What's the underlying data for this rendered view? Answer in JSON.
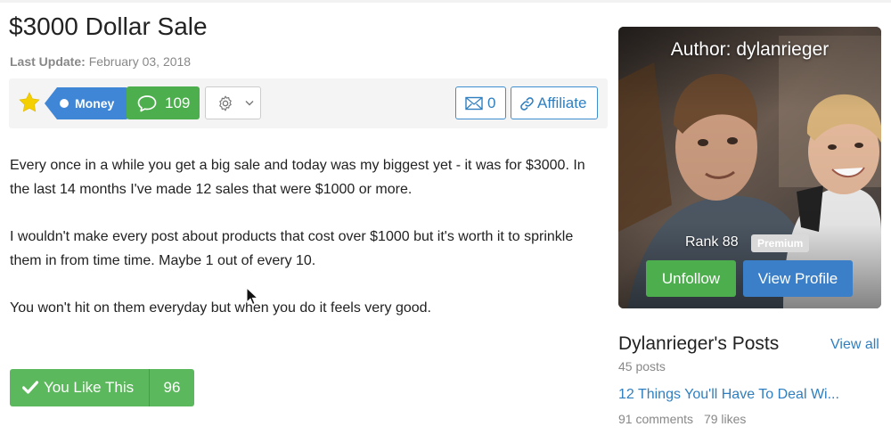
{
  "post": {
    "title": "$3000 Dollar Sale",
    "last_update_label": "Last Update:",
    "last_update_date": "February 03, 2018",
    "tag": "Money",
    "comment_count": "109",
    "message_count": "0",
    "affiliate_label": "Affiliate",
    "paragraphs": [
      "Every once in a while you get a big sale and today was my biggest yet - it was for $3000. In the last 14 months I've made 12 sales that were $1000 or more.",
      "I wouldn't make every post about products that cost over $1000 but it's worth it to sprinkle them in from time time. Maybe 1 out of every 10.",
      "You won't hit on them everyday but when you do it feels very good."
    ],
    "like_label": "You Like This",
    "like_count": "96"
  },
  "author": {
    "title": "Author: dylanrieger",
    "rank": "Rank 88",
    "badge": "Premium",
    "unfollow_label": "Unfollow",
    "view_profile_label": "View Profile"
  },
  "sidebar": {
    "heading": "Dylanrieger's Posts",
    "view_all": "View all",
    "posts_count": "45 posts",
    "recent_post": {
      "title": "12 Things You'll Have To Deal Wi...",
      "comments": "91 comments",
      "likes": "79 likes"
    }
  },
  "colors": {
    "green": "#4cae4c",
    "blue": "#3a7fc7",
    "link": "#2f7fc0",
    "tag_blue": "#3f86d6"
  },
  "icons": {
    "star": "star-icon",
    "tag_dot": "dot-icon",
    "comments": "speech-bubble-icon",
    "settings": "gear-icon",
    "dropdown": "chevron-down-icon",
    "message": "envelope-icon",
    "affiliate": "link-icon",
    "like": "checkmark-icon",
    "cursor": "mouse-pointer-icon"
  }
}
